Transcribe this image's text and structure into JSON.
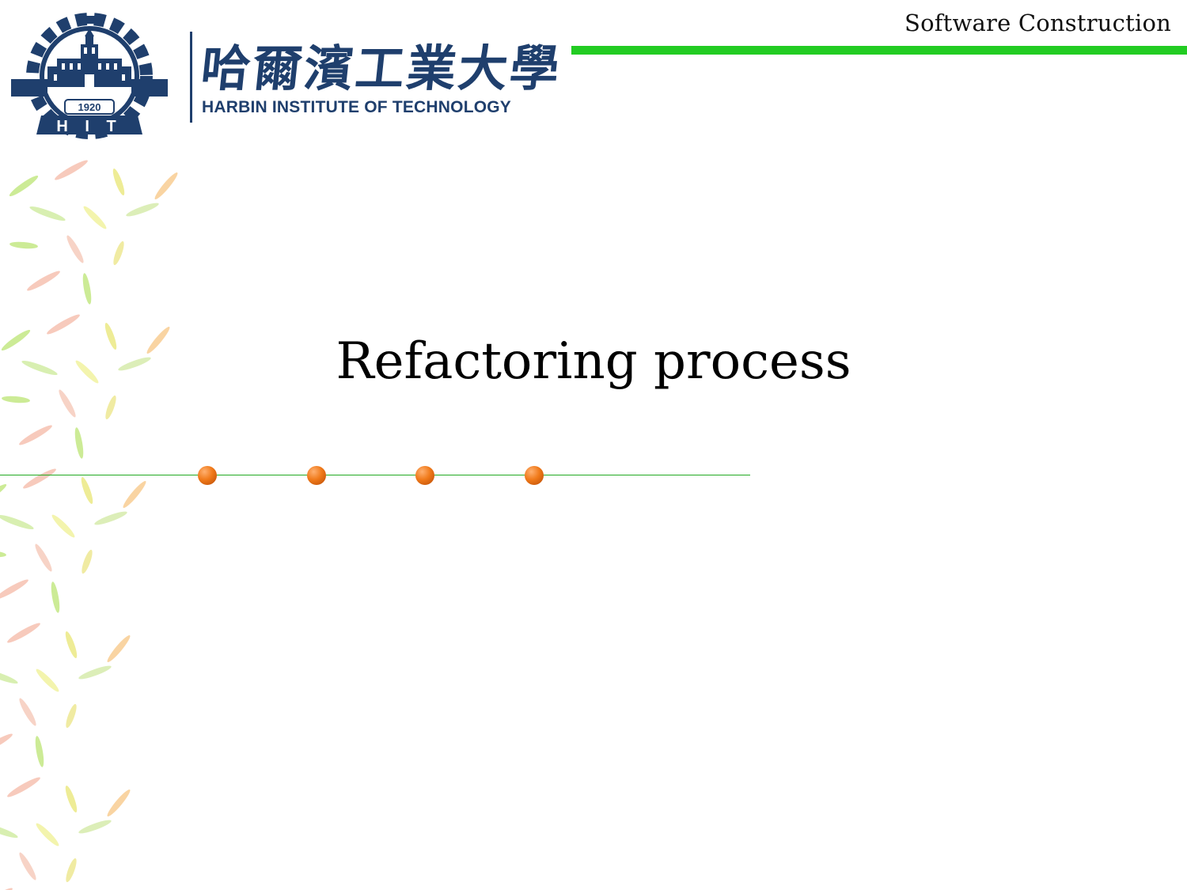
{
  "header": {
    "course_title": "Software Construction",
    "accent_color": "#22cc22"
  },
  "logo": {
    "chinese_name": "哈爾濱工業大學",
    "english_name": "HARBIN INSTITUTE OF TECHNOLOGY",
    "emblem_year": "1920",
    "emblem_letters": "H I T",
    "brand_color": "#1f3f6d"
  },
  "main": {
    "title": "Refactoring process"
  },
  "decor": {
    "dot_color": "#f07a1a",
    "dot_count": 4,
    "line_color": "#22aa22"
  }
}
